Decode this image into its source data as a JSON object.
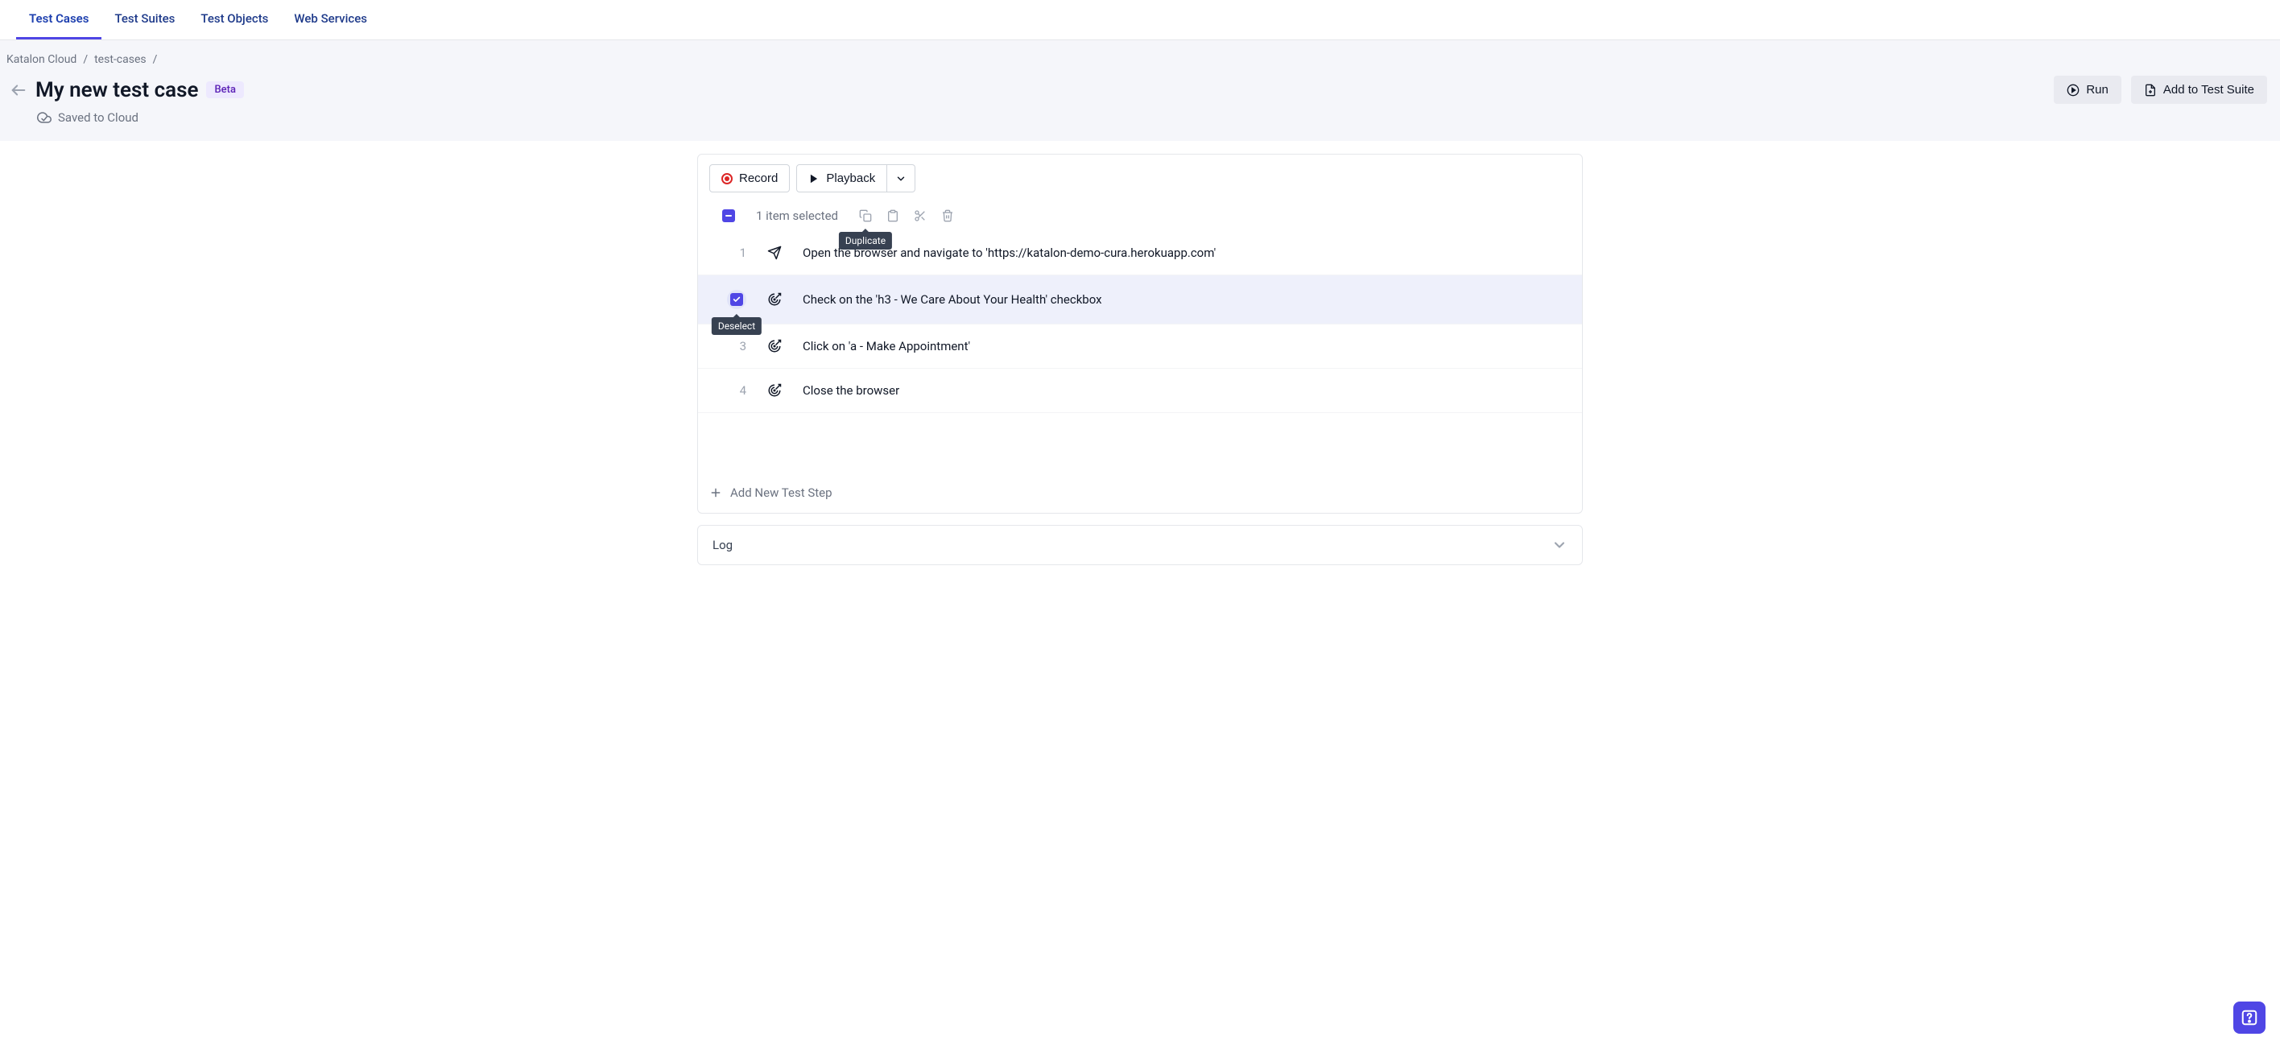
{
  "nav": {
    "tabs": [
      "Test Cases",
      "Test Suites",
      "Test Objects",
      "Web Services"
    ],
    "active_index": 0
  },
  "breadcrumb": {
    "items": [
      "Katalon Cloud",
      "test-cases"
    ]
  },
  "page": {
    "title": "My new test case",
    "badge": "Beta",
    "saved_status": "Saved to Cloud"
  },
  "actions": {
    "run": "Run",
    "add_suite": "Add to Test Suite"
  },
  "toolbar": {
    "record": "Record",
    "playback": "Playback"
  },
  "selection": {
    "count_text": "1 item selected",
    "tooltip_duplicate": "Duplicate",
    "tooltip_deselect": "Deselect"
  },
  "steps": [
    {
      "num": "1",
      "icon": "navigate",
      "text": "Open the browser and navigate to 'https://katalon-demo-cura.herokuapp.com'",
      "selected": false
    },
    {
      "num": "",
      "icon": "target",
      "text": "Check on the 'h3 - We Care About Your Health' checkbox",
      "selected": true
    },
    {
      "num": "3",
      "icon": "target",
      "text": "Click on 'a - Make Appointment'",
      "selected": false
    },
    {
      "num": "4",
      "icon": "target",
      "text": "Close the browser",
      "selected": false
    }
  ],
  "add_step": "Add New Test Step",
  "log": {
    "title": "Log"
  }
}
